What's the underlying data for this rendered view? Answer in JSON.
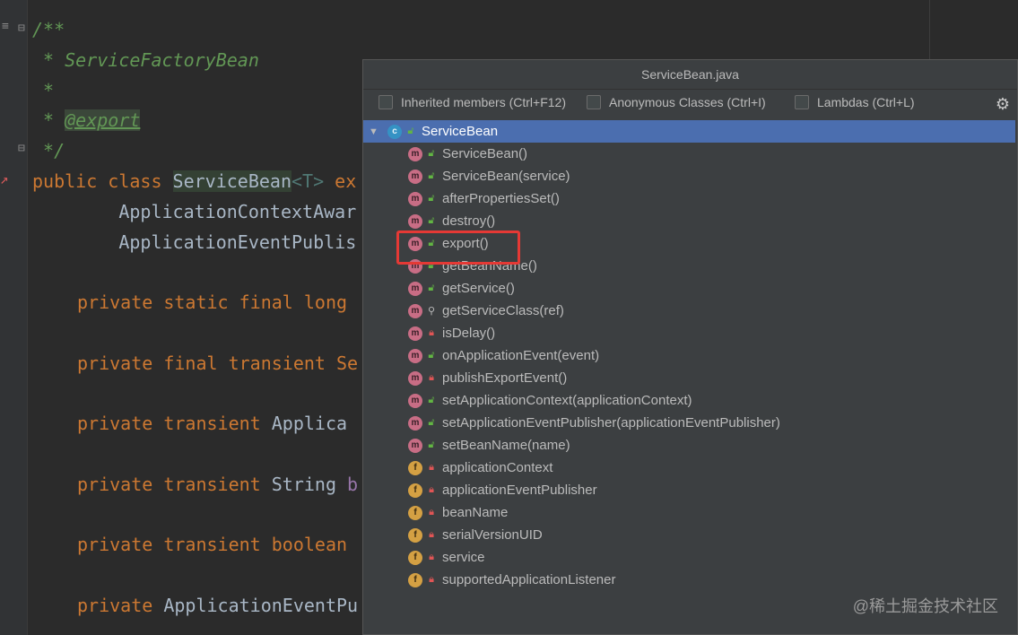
{
  "editor": {
    "lines": {
      "l1": "/**",
      "l2": " * ServiceFactoryBean",
      "l3": " *",
      "l4_prefix": " * ",
      "l4_tag": "@export",
      "l5": " */",
      "l6_kw": "public class ",
      "l6_cls": "ServiceBean",
      "l6_tp": "<T>",
      "l6_tail": " ex",
      "l7": "        ApplicationContextAwar",
      "l8": "        ApplicationEventPublis",
      "l9_kw": "private static final long",
      "l10_kw": "private final transient ",
      "l10_ty": "Se",
      "l11_kw": "private transient ",
      "l11_ty": "Applica",
      "l12_kw": "private transient ",
      "l12_ty": "String",
      "l12_tail": " b",
      "l13_kw": "private transient boolean",
      "l14_kw": "private ",
      "l14_ty": "ApplicationEventPu"
    }
  },
  "popup": {
    "title": "ServiceBean.java",
    "options": {
      "inherited": "Inherited members (Ctrl+F12)",
      "anonymous": "Anonymous Classes (Ctrl+I)",
      "lambdas": "Lambdas (Ctrl+L)"
    },
    "root": {
      "label": "ServiceBean",
      "icon": "class-icon",
      "expanded": true
    },
    "items": [
      {
        "label": "ServiceBean()",
        "kind": "m",
        "vis": "public"
      },
      {
        "label": "ServiceBean(service)",
        "kind": "m",
        "vis": "public"
      },
      {
        "label": "afterPropertiesSet()",
        "kind": "m",
        "vis": "public"
      },
      {
        "label": "destroy()",
        "kind": "m",
        "vis": "public"
      },
      {
        "label": "export()",
        "kind": "m",
        "vis": "public"
      },
      {
        "label": "getBeanName()",
        "kind": "m",
        "vis": "public"
      },
      {
        "label": "getService()",
        "kind": "m",
        "vis": "public"
      },
      {
        "label": "getServiceClass(ref)",
        "kind": "m",
        "vis": "package"
      },
      {
        "label": "isDelay()",
        "kind": "m",
        "vis": "private"
      },
      {
        "label": "onApplicationEvent(event)",
        "kind": "m",
        "vis": "public"
      },
      {
        "label": "publishExportEvent()",
        "kind": "m",
        "vis": "private"
      },
      {
        "label": "setApplicationContext(applicationContext)",
        "kind": "m",
        "vis": "public"
      },
      {
        "label": "setApplicationEventPublisher(applicationEventPublisher)",
        "kind": "m",
        "vis": "public"
      },
      {
        "label": "setBeanName(name)",
        "kind": "m",
        "vis": "public"
      },
      {
        "label": "applicationContext",
        "kind": "f",
        "vis": "private"
      },
      {
        "label": "applicationEventPublisher",
        "kind": "f",
        "vis": "private"
      },
      {
        "label": "beanName",
        "kind": "f",
        "vis": "private"
      },
      {
        "label": "serialVersionUID",
        "kind": "f",
        "vis": "private"
      },
      {
        "label": "service",
        "kind": "f",
        "vis": "private"
      },
      {
        "label": "supportedApplicationListener",
        "kind": "f",
        "vis": "private"
      }
    ]
  },
  "watermark": "@稀土掘金技术社区",
  "colors": {
    "selection": "#4b6eaf",
    "highlight_box": "#e53935",
    "method_icon": "#c86d85",
    "field_icon": "#d4a043"
  }
}
